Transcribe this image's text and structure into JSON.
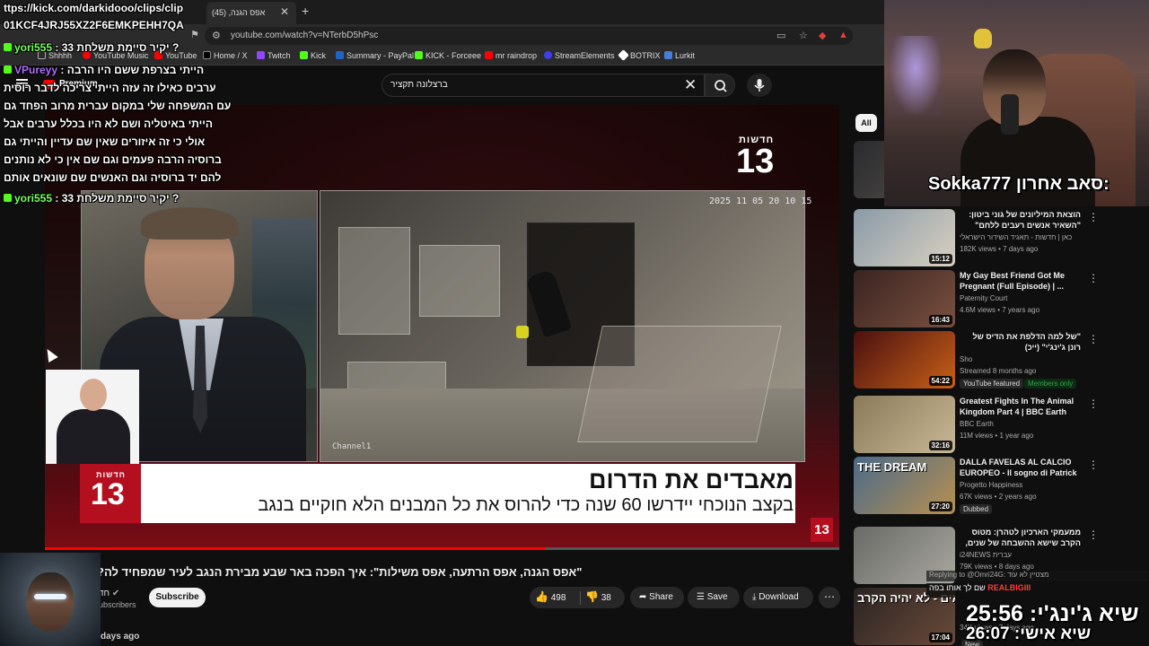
{
  "browser": {
    "tab_title": "אפס הגנה, (45)",
    "url": "youtube.com/watch?v=NTerbD5hPsc",
    "bookmarks": [
      "Shhhh",
      "YouTube Music",
      "YouTube",
      "Home / X",
      "Twitch",
      "Kick",
      "Summary - PayPal",
      "KICK - Forceee",
      "mr raindrop",
      "StreamElements",
      "BOTRIX",
      "Lurkit"
    ]
  },
  "youtube": {
    "premium_label": "Premium",
    "search_query": "ברצלונה תקציר",
    "chip_all": "All"
  },
  "player": {
    "channel_logo_word": "חדשות",
    "channel_logo_num": "13",
    "cctv_timestamp": "2025 11 05 20 10 15",
    "cctv_camera": "Channel1",
    "headline": "מאבדים את הדרום",
    "subheadline": "בקצב הנוכחי יידרשו 60 שנה כדי להרוס את כל המבנים הלא חוקיים בנגב",
    "progress": 0.63
  },
  "video": {
    "title": "\"אפס הגנה, אפס הרתעה, אפס משילות\": איך הפכה באר שבע מבירת הנגב לעיר שמפחיד לה?",
    "channel": "חד",
    "subscribers": "ubscribers",
    "subscribe_label": "Subscribe",
    "likes": "498",
    "dislikes": "38",
    "share": "Share",
    "save": "Save",
    "download": "Download",
    "date_snippet": "days ago"
  },
  "recommendations": [
    {
      "title": "",
      "channel": "",
      "meta": "",
      "duration": "16:15",
      "badge": "New"
    },
    {
      "title": "הוצאת המיליונים של גוני ביטון: \"השאיר אנשים רעבים ללחם\"",
      "channel": "כאן | חדשות - תאגיד השידור הישראלי",
      "meta": "182K views • 7 days ago",
      "duration": "15:12",
      "rtl": true
    },
    {
      "title": "My Gay Best Friend Got Me Pregnant (Full Episode) | ...",
      "channel": "Paternity Court",
      "meta": "4.6M views • 7 years ago",
      "duration": "16:43"
    },
    {
      "title": "\"של למה הדלפת את הדיס של רונן ג'ינג'י\" (ייכ)",
      "channel": "Sho",
      "meta": "Streamed 8 months ago",
      "duration": "54:22",
      "rtl": true,
      "badge": "YouTube featured",
      "badge2": "Members only"
    },
    {
      "title": "Greatest Fights In The Animal Kingdom Part 4 | BBC Earth",
      "channel": "BBC Earth",
      "meta": "11M views • 1 year ago",
      "duration": "32:16"
    },
    {
      "title": "DALLA FAVELAS AL CALCIO EUROPEO - Il sogno di Patrick ...",
      "channel": "Progetto Happiness",
      "meta": "67K views • 2 years ago",
      "duration": "27:20",
      "badge": "Dubbed",
      "thumb_text": "THE DREAM"
    },
    {
      "title": "ממעמקי הארכיון לטהרן: מטוס הקרב שישא ההשבחה של שנים, כדי",
      "channel": "i24NEWS עברית",
      "meta": "79K views • 8 days ago",
      "duration": "",
      "rtl": true
    },
    {
      "title": "",
      "channel": "",
      "meta": "34K views • 7 days ago",
      "duration": "17:04",
      "badge": "New",
      "thumb_text": "לוחמים - לא יהיה הקרב"
    }
  ],
  "stream": {
    "clip_url": "ttps://kick.com/darkidooo/clips/clip",
    "clip_id": "01KCF4JRJ55XZ2F6EMKPEHH7QA",
    "chat": [
      {
        "user": "yori555",
        "text": "יקיר סיימת משלחת 33 ?"
      },
      {
        "user": "VPureyy",
        "text": "הייתי בצרפת ששם היו הרבה"
      },
      {
        "user": "",
        "text": "ערבים כאילו זה עזה הייתי צריכה לדבר רוסית"
      },
      {
        "user": "",
        "text": "עם המשפחה שלי במקום עברית מרוב הפחד גם"
      },
      {
        "user": "",
        "text": "הייתי באיטליה ושם לא היו בכלל ערבים אבל"
      },
      {
        "user": "",
        "text": "אולי כי זה איזורים שאין שם עדיין והייתי גם"
      },
      {
        "user": "",
        "text": "ברוסיה הרבה פעמים וגם שם אין כי לא נותנים"
      },
      {
        "user": "",
        "text": "להם יד ברוסיה וגם האנשים שם שונאים אותם"
      },
      {
        "user": "yori555",
        "text": "יקיר סיימת משלחת 33 ?"
      }
    ],
    "last_sub_label": "סאב אחרון:",
    "last_sub_user": "Sokka777",
    "replying_to": "Replying to @Omri24G: מצטיין לא עוד",
    "bottom_chat_user": "REALBIGIII",
    "bottom_chat_text": "שם לך אותו בפה",
    "timer1_label": "שיא ג'ינג'י:",
    "timer1_value": "25:56",
    "timer2_label": "שיא אישי:",
    "timer2_value": "26:07"
  },
  "colors": {
    "yt_bg": "#0f0f0f",
    "accent_red": "#ff0000",
    "news_red": "#b30f1f",
    "kick_green": "#53fc18"
  }
}
